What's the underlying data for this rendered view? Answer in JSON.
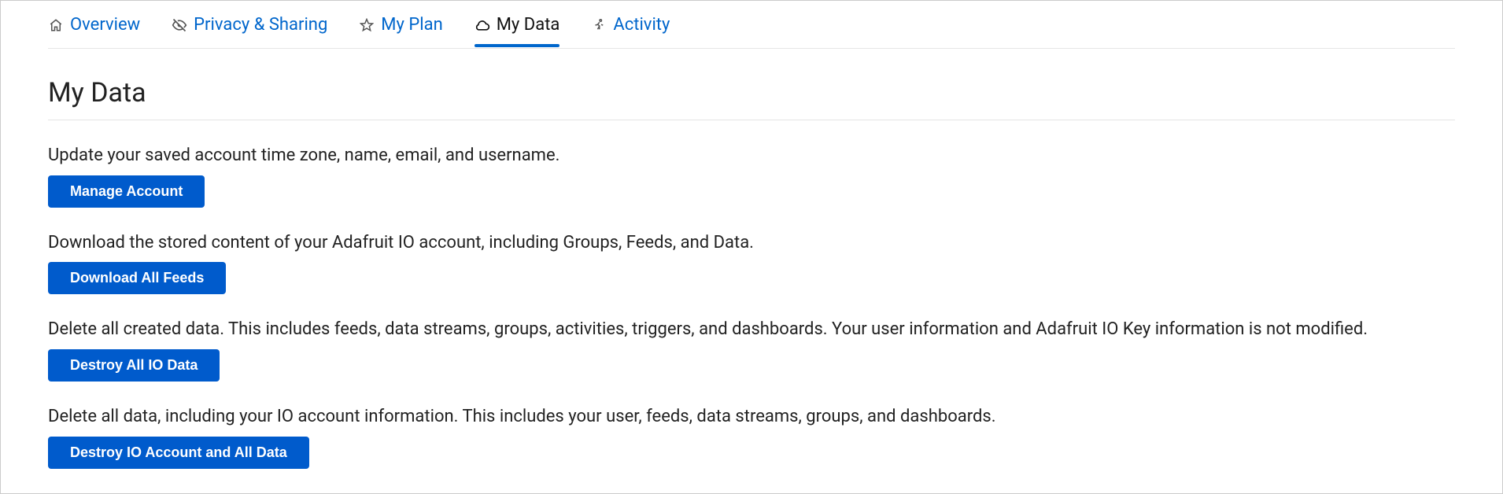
{
  "tabs": [
    {
      "label": "Overview",
      "icon": "home-icon",
      "active": false
    },
    {
      "label": "Privacy & Sharing",
      "icon": "eye-off-icon",
      "active": false
    },
    {
      "label": "My Plan",
      "icon": "star-icon",
      "active": false
    },
    {
      "label": "My Data",
      "icon": "cloud-icon",
      "active": true
    },
    {
      "label": "Activity",
      "icon": "running-icon",
      "active": false
    }
  ],
  "page_title": "My Data",
  "sections": [
    {
      "desc": "Update your saved account time zone, name, email, and username.",
      "button": "Manage Account"
    },
    {
      "desc": "Download the stored content of your Adafruit IO account, including Groups, Feeds, and Data.",
      "button": "Download All Feeds"
    },
    {
      "desc": "Delete all created data. This includes feeds, data streams, groups, activities, triggers, and dashboards. Your user information and Adafruit IO Key information is not modified.",
      "button": "Destroy All IO Data"
    },
    {
      "desc": "Delete all data, including your IO account information. This includes your user, feeds, data streams, groups, and dashboards.",
      "button": "Destroy IO Account and All Data"
    }
  ]
}
